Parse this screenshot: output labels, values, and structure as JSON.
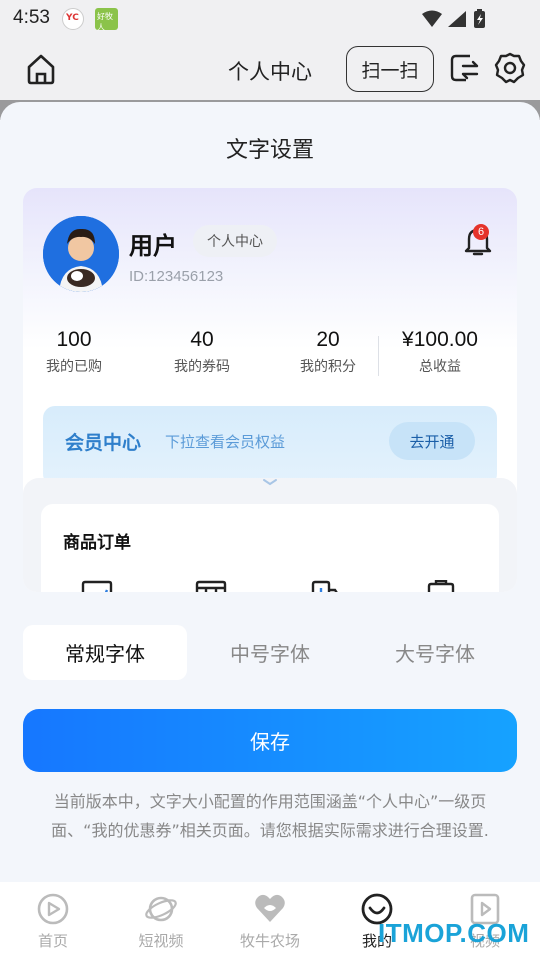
{
  "status_bar": {
    "time": "4:53",
    "app1_badge": "YC",
    "app2_badge": "好牧人"
  },
  "header": {
    "title": "个人中心",
    "scan_label": "扫一扫"
  },
  "sheet": {
    "title": "文字设置",
    "preview": {
      "user_name": "用户",
      "center_tag": "个人中心",
      "user_id": "ID:123456123",
      "notification_count": "6",
      "stats": [
        {
          "value": "100",
          "label": "我的已购"
        },
        {
          "value": "40",
          "label": "我的券码"
        },
        {
          "value": "20",
          "label": "我的积分"
        },
        {
          "value": "¥100.00",
          "label": "总收益"
        }
      ],
      "member": {
        "title": "会员中心",
        "desc": "下拉查看会员权益",
        "button": "去开通"
      },
      "orders_title": "商品订单"
    },
    "font_tabs": [
      {
        "label": "常规字体",
        "active": true
      },
      {
        "label": "中号字体",
        "active": false
      },
      {
        "label": "大号字体",
        "active": false
      }
    ],
    "save_label": "保存",
    "note": "当前版本中，文字大小配置的作用范围涵盖“个人中心”一级页面、“我的优惠券”相关页面。请您根据实际需求进行合理设置."
  },
  "bottom_nav": [
    {
      "label": "首页",
      "icon": "play-circle-icon"
    },
    {
      "label": "短视频",
      "icon": "planet-icon"
    },
    {
      "label": "牧牛农场",
      "icon": "heart-leaf-icon"
    },
    {
      "label": "我的",
      "icon": "smile-icon",
      "active": true
    },
    {
      "label": "视频",
      "icon": "video-icon"
    }
  ],
  "watermark": "ITMOP.COM",
  "colors": {
    "accent": "#1677ff",
    "member_blue": "#2f7fcb",
    "badge_red": "#e5332b"
  }
}
